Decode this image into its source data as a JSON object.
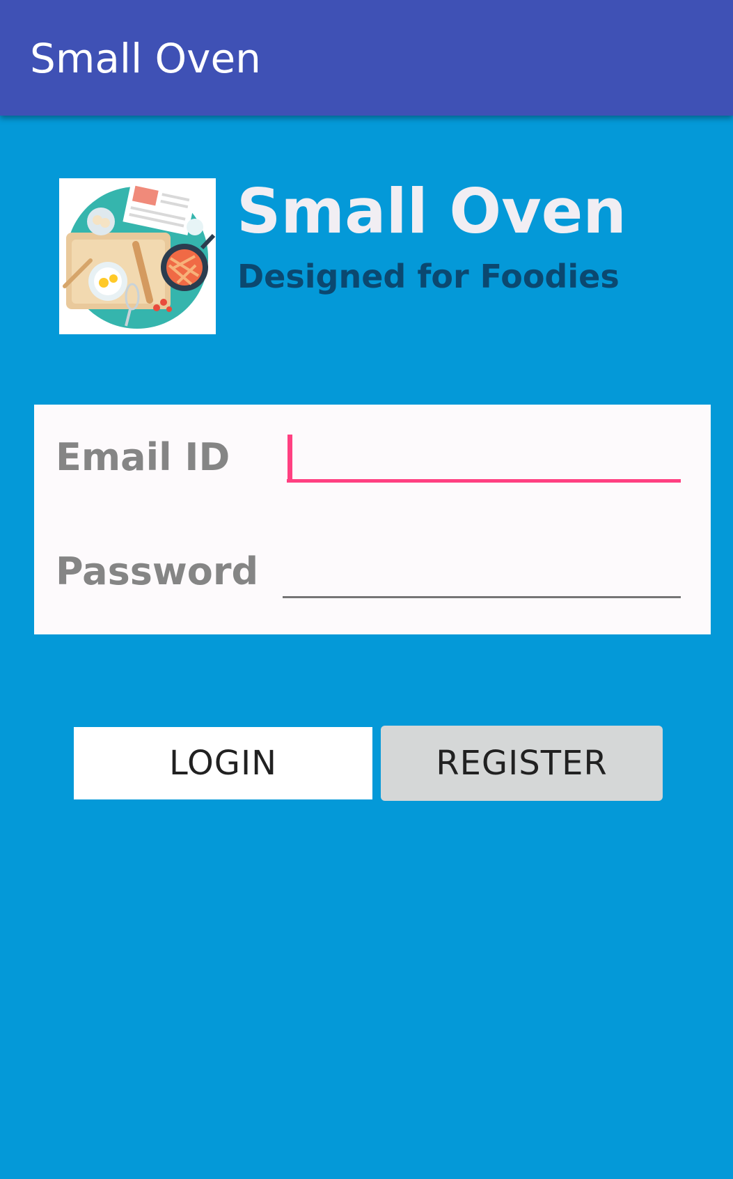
{
  "app_bar": {
    "title": "Small Oven"
  },
  "brand": {
    "logo_icon": "cooking-table-illustration-icon",
    "title": "Small Oven",
    "subtitle": "Designed for Foodies"
  },
  "form": {
    "email_label": "Email ID",
    "email_value": "",
    "password_label": "Password",
    "password_value": ""
  },
  "buttons": {
    "login_label": "LOGIN",
    "register_label": "REGISTER"
  },
  "colors": {
    "app_bar": "#3f51b5",
    "background": "#0499d8",
    "accent": "#ff4081",
    "subtitle": "#0b4870"
  }
}
